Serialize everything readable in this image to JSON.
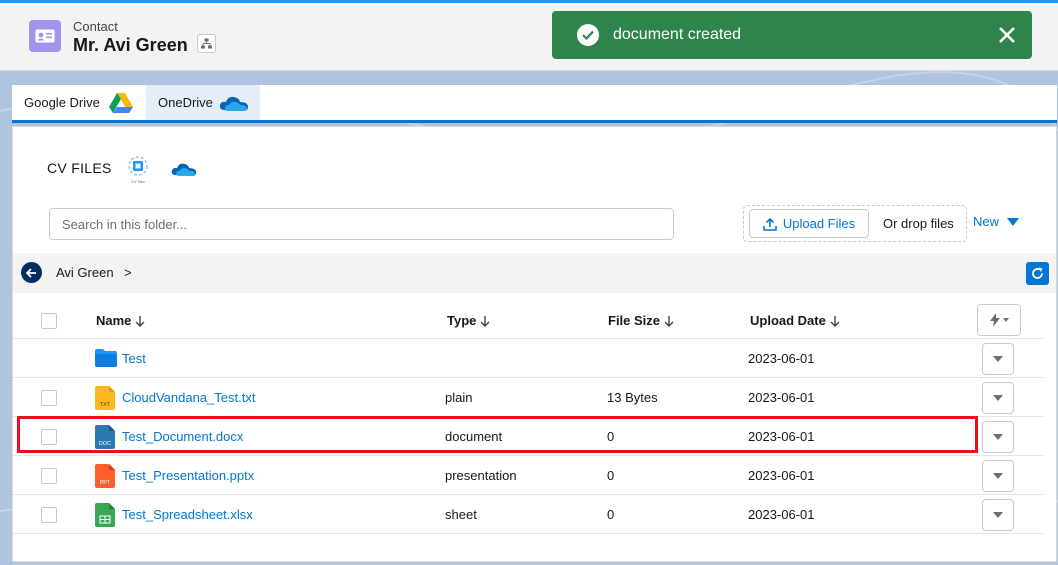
{
  "header": {
    "object_label": "Contact",
    "record_name": "Mr. Avi Green"
  },
  "toast": {
    "message": "document created",
    "variant": "success",
    "color": "#2e844a"
  },
  "tabs": [
    {
      "label": "Google Drive",
      "icon": "google-drive-icon",
      "active": false
    },
    {
      "label": "OneDrive",
      "icon": "onedrive-icon",
      "active": true
    }
  ],
  "card": {
    "title": "CV FILES",
    "cv_icon_caption": "CV files"
  },
  "search": {
    "placeholder": "Search in this folder..."
  },
  "upload": {
    "button_label": "Upload Files",
    "drop_text": "Or drop files",
    "new_label": "New"
  },
  "breadcrumb": {
    "items": [
      "Avi Green"
    ],
    "separator": ">"
  },
  "table": {
    "columns": [
      "Name",
      "Type",
      "File Size",
      "Upload Date"
    ],
    "rows": [
      {
        "name": "Test",
        "icon": "folder-icon",
        "type": "",
        "size": "",
        "date": "2023-06-01"
      },
      {
        "name": "CloudVandana_Test.txt",
        "icon": "txt-file-icon",
        "type": "plain",
        "size": "13 Bytes",
        "date": "2023-06-01"
      },
      {
        "name": "Test_Document.docx",
        "icon": "doc-file-icon",
        "type": "document",
        "size": "0",
        "date": "2023-06-01",
        "highlighted": true
      },
      {
        "name": "Test_Presentation.pptx",
        "icon": "ppt-file-icon",
        "type": "presentation",
        "size": "0",
        "date": "2023-06-01"
      },
      {
        "name": "Test_Spreadsheet.xlsx",
        "icon": "xlsx-file-icon",
        "type": "sheet",
        "size": "0",
        "date": "2023-06-01"
      }
    ]
  },
  "file_icons": {
    "txt_label": "TXT",
    "doc_label": "DOC",
    "ppt_label": "PPT"
  },
  "colors": {
    "brand": "#0176d3",
    "highlight": "#e8101a",
    "contact_icon": "#a094ed"
  }
}
